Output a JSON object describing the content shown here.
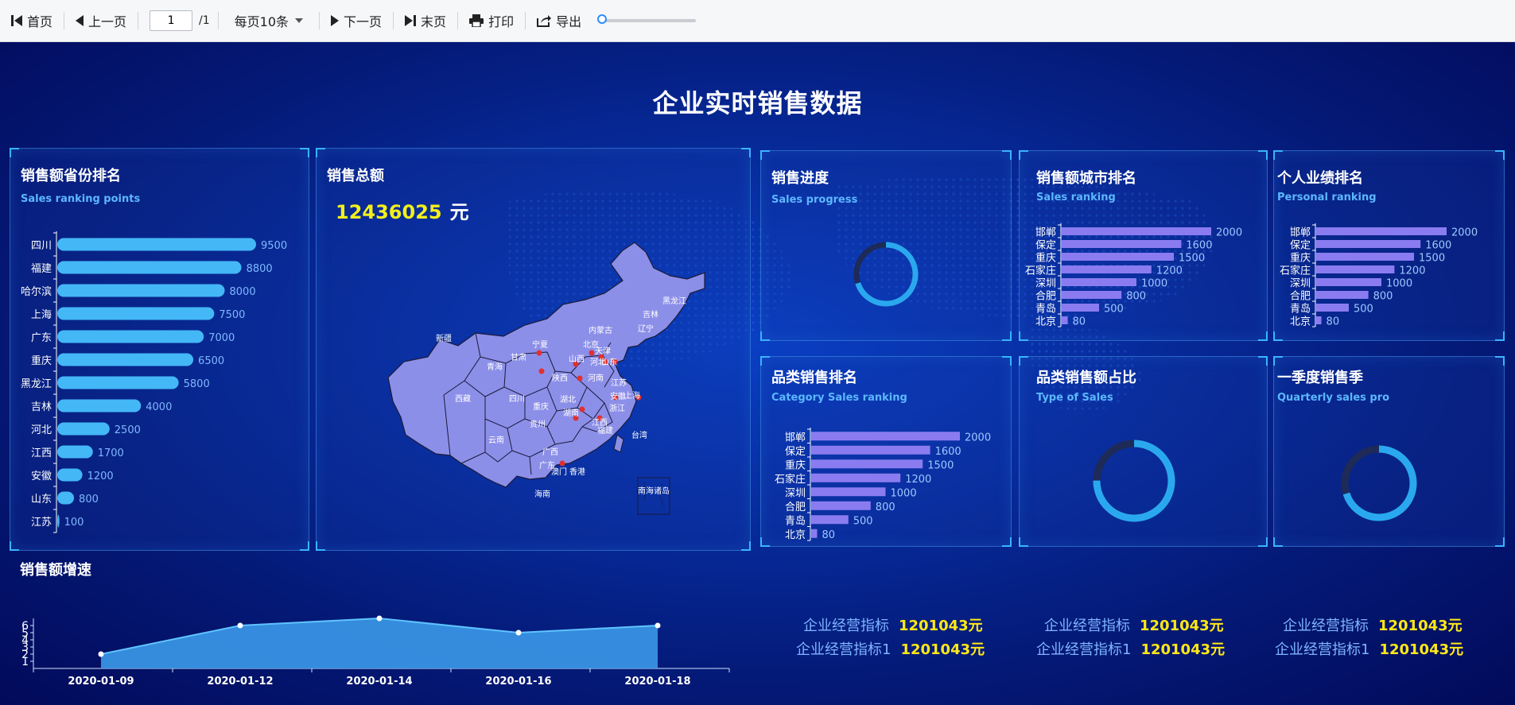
{
  "toolbar": {
    "first": "首页",
    "prev": "上一页",
    "page_value": "1",
    "page_total": "/1",
    "per_page": "每页10条",
    "next": "下一页",
    "last": "末页",
    "print": "打印",
    "export": "导出"
  },
  "dashboard": {
    "title": "企业实时销售数据",
    "province_panel": {
      "title": "销售额省份排名",
      "subtitle": "Sales ranking points"
    },
    "total_panel": {
      "title": "销售总额",
      "amount": "12436025",
      "unit": "元"
    },
    "progress_panel": {
      "title": "销售进度",
      "subtitle": "Sales progress"
    },
    "city_panel": {
      "title": "销售额城市排名",
      "subtitle": "Sales ranking"
    },
    "personal_panel": {
      "title": "个人业绩排名",
      "subtitle": "Personal ranking"
    },
    "category_panel": {
      "title": "品类销售排名",
      "subtitle": "Category Sales ranking"
    },
    "type_panel": {
      "title": "品类销售额占比",
      "subtitle": "Type of Sales"
    },
    "quarter_panel": {
      "title": "一季度销售季",
      "subtitle": "Quarterly sales pro"
    },
    "growth_panel": {
      "title": "销售额增速"
    },
    "metrics": [
      {
        "label": "企业经营指标",
        "value": "1201043元"
      },
      {
        "label": "企业经营指标",
        "value": "1201043元"
      },
      {
        "label": "企业经营指标",
        "value": "1201043元"
      },
      {
        "label": "企业经营指标1",
        "value": "1201043元"
      },
      {
        "label": "企业经营指标1",
        "value": "1201043元"
      },
      {
        "label": "企业经营指标1",
        "value": "1201043元"
      }
    ],
    "map_labels": [
      "黑龙江",
      "吉林",
      "辽宁",
      "内蒙古",
      "新疆",
      "宁夏",
      "山西",
      "北京",
      "河北",
      "天津",
      "山东",
      "青海",
      "甘肃",
      "陕西",
      "河南",
      "江苏",
      "安徽",
      "上海",
      "西藏",
      "四川",
      "湖北",
      "重庆",
      "湖南",
      "浙江",
      "贵州",
      "江西",
      "云南",
      "广西",
      "福建",
      "台湾",
      "广东",
      "澳门",
      "香港",
      "海南",
      "南海诸岛"
    ],
    "donuts": {
      "progress": 0.7,
      "type": 0.75,
      "quarter": 0.7
    },
    "colors": {
      "bar_blue": "#44b7f7",
      "bar_purple": "#8a7cf0",
      "ring": "#2aa8ef",
      "ring_bg": "#1e2a57",
      "highlight": "#ffe818"
    }
  },
  "chart_data": [
    {
      "type": "bar",
      "orientation": "horizontal",
      "categories": [
        "四川",
        "福建",
        "哈尔滨",
        "上海",
        "广东",
        "重庆",
        "黑龙江",
        "吉林",
        "河北",
        "江西",
        "安徽",
        "山东",
        "江苏"
      ],
      "values": [
        9500,
        8800,
        8000,
        7500,
        7000,
        6500,
        5800,
        4000,
        2500,
        1700,
        1200,
        800,
        100
      ]
    },
    {
      "type": "bar",
      "orientation": "horizontal",
      "categories": [
        "邯郸",
        "保定",
        "重庆",
        "石家庄",
        "深圳",
        "合肥",
        "青岛",
        "北京"
      ],
      "values": [
        2000,
        1600,
        1500,
        1200,
        1000,
        800,
        500,
        80
      ]
    },
    {
      "type": "bar",
      "orientation": "horizontal",
      "categories": [
        "邯郸",
        "保定",
        "重庆",
        "石家庄",
        "深圳",
        "合肥",
        "青岛",
        "北京"
      ],
      "values": [
        2000,
        1600,
        1500,
        1200,
        1000,
        800,
        500,
        80
      ]
    },
    {
      "type": "bar",
      "orientation": "horizontal",
      "categories": [
        "邯郸",
        "保定",
        "重庆",
        "石家庄",
        "深圳",
        "合肥",
        "青岛",
        "北京"
      ],
      "values": [
        2000,
        1600,
        1500,
        1200,
        1000,
        800,
        500,
        80
      ]
    },
    {
      "type": "area",
      "x": [
        "2020-01-09",
        "2020-01-12",
        "2020-01-14",
        "2020-01-16",
        "2020-01-18"
      ],
      "values": [
        2,
        6,
        7,
        5,
        6
      ],
      "yticks": [
        1,
        2,
        3,
        4,
        5,
        6
      ],
      "ylim": [
        0,
        7
      ]
    }
  ]
}
